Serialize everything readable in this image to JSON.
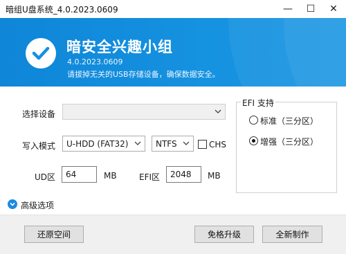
{
  "window": {
    "title": "暗组U盘系统_4.0.2023.0609",
    "minimize_glyph": "—",
    "maximize_glyph": "☐",
    "close_glyph": "✕"
  },
  "banner": {
    "brand": "暗安全兴趣小组",
    "version": "4.0.2023.0609",
    "notice": "请拔掉无关的USB存储设备，确保数据安全。",
    "bg_color": "#1590df",
    "logo_icon": "checkmark-icon"
  },
  "form": {
    "device_label": "选择设备",
    "device_value": "",
    "write_mode_label": "写入模式",
    "write_mode_value": "U-HDD (FAT32)",
    "fs_value": "NTFS",
    "chs_label": "CHS",
    "chs_checked": false,
    "ud_label": "UD区",
    "ud_value": "64",
    "ud_unit": "MB",
    "efi_label": "EFI区",
    "efi_value": "2048",
    "efi_unit": "MB"
  },
  "efi_support": {
    "title": "EFI 支持",
    "options": [
      {
        "label": "标准（三分区）",
        "selected": false
      },
      {
        "label": "增强（三分区）",
        "selected": true
      }
    ]
  },
  "advanced": {
    "label": "高级选项",
    "icon": "chevron-down-circle-icon",
    "accent": "#1a8be0"
  },
  "buttons": {
    "restore": "还原空间",
    "upgrade": "免格升级",
    "new_make": "全新制作"
  }
}
